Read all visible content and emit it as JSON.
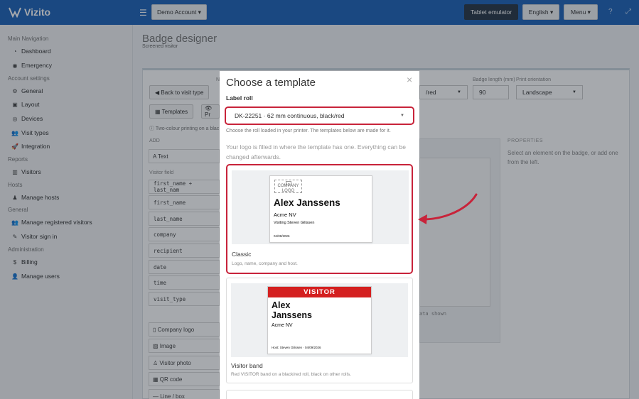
{
  "topbar": {
    "brand": "Vizito",
    "account_label": "Demo Account ▾",
    "tablet_label": "Tablet emulator",
    "language_label": "English ▾",
    "menu_label": "Menu ▾",
    "help_icon": "?",
    "expand_icon": "⤢"
  },
  "sidebar": {
    "sections": {
      "main": "Main Navigation",
      "account": "Account settings",
      "reports": "Reports",
      "hosts": "Hosts",
      "general": "General",
      "admin": "Administration"
    },
    "items": [
      {
        "label": "Dashboard",
        "icon": "◔"
      },
      {
        "label": "Emergency",
        "icon": "◉"
      },
      {
        "label": "General",
        "icon": "⚙"
      },
      {
        "label": "Layout",
        "icon": "▣"
      },
      {
        "label": "Devices",
        "icon": "◎"
      },
      {
        "label": "Visit types",
        "icon": "👥"
      },
      {
        "label": "Integration",
        "icon": "🚀"
      },
      {
        "label": "Visitors",
        "icon": "▥"
      },
      {
        "label": "Manage hosts",
        "icon": "♟"
      },
      {
        "label": "Manage registered visitors",
        "icon": "👥"
      },
      {
        "label": "Visitor sign in",
        "icon": "✎"
      },
      {
        "label": "Billing",
        "icon": "$"
      },
      {
        "label": "Manage users",
        "icon": "👤"
      }
    ]
  },
  "page": {
    "title": "Badge designer",
    "subtitle": "Screened visitor"
  },
  "background": {
    "back_button": "◀ Back to visit type",
    "templates_button": "▦ Templates",
    "preview_button": "👁 Pr",
    "two_colour_note": "ⓘ Two-colour printing on a blac",
    "add_label": "ADD",
    "text_item": "A Text",
    "visitor_field_label": "Visitor field",
    "fields": [
      "first_name + last_nam",
      "first_name",
      "last_name",
      "company",
      "recipient",
      "date",
      "time",
      "visit_type"
    ],
    "elements": [
      "▯ Company logo",
      "▨ Image",
      "♙ Visitor photo",
      "▦ QR code",
      "— Line / box"
    ],
    "roll_select_partial": "/red",
    "badge_length_label": "Badge length (mm)",
    "badge_length_value": "90",
    "orientation_label": "Print orientation",
    "orientation_value": "Landscape",
    "properties_label": "PROPERTIES",
    "properties_hint": "Select an element on the badge, or add one from the left.",
    "data_shown": "ata shown",
    "field_label_n": "N"
  },
  "modal": {
    "title": "Choose a template",
    "close": "×",
    "label_roll": "Label roll",
    "roll_value": "DK-22251 · 62 mm continuous, black/red",
    "roll_help": "Choose the roll loaded in your printer. The templates below are made for it.",
    "note": "Your logo is filled in where the template has one. Everything can be changed afterwards.",
    "templates": [
      {
        "name": "Classic",
        "desc": "Logo, name, company and host.",
        "logo_text": "COMPANY LOGO",
        "visitor_name": "Alex Janssens",
        "company": "Acme NV",
        "host": "Visiting Steven Gilissen",
        "date": "04/09/2026"
      },
      {
        "name": "Visitor band",
        "desc": "Red VISITOR band on a black/red roll, black on other rolls.",
        "band": "VISITOR",
        "visitor_first": "Alex",
        "visitor_last": "Janssens",
        "company": "Acme NV",
        "host": "Host: Steven Gilissen · 04/09/2026"
      }
    ]
  },
  "colors": {
    "brand_blue": "#1e63b8",
    "highlight_red": "#c8233a",
    "band_red": "#d42020"
  }
}
